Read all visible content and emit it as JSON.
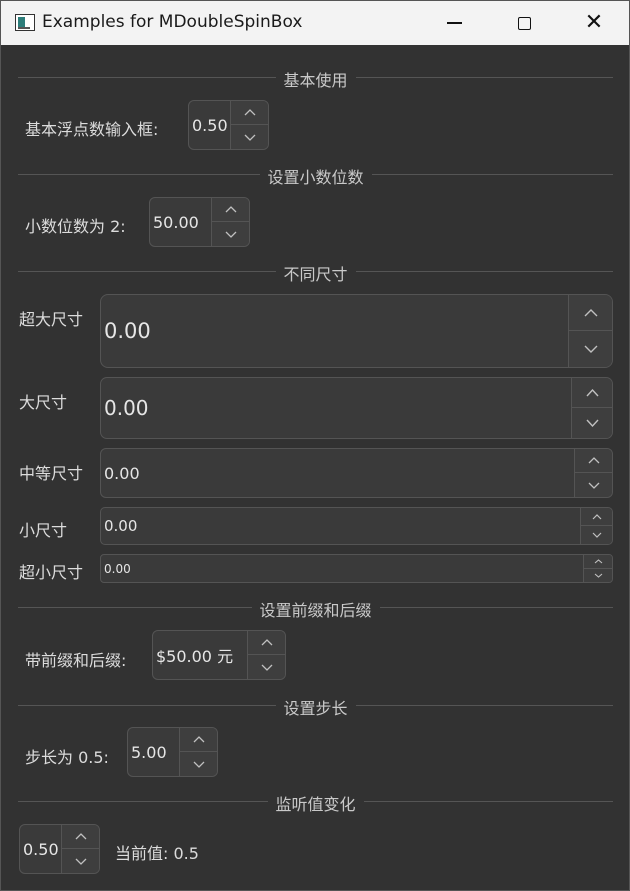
{
  "window": {
    "title": "Examples for MDoubleSpinBox",
    "controls": {
      "minimize": "minimize",
      "maximize": "maximize",
      "close": "close"
    }
  },
  "sections": {
    "basic": "基本使用",
    "decimals": "设置小数位数",
    "sizes": "不同尺寸",
    "prefix_suffix": "设置前缀和后缀",
    "step": "设置步长",
    "listen": "监听值变化"
  },
  "basic": {
    "label": "基本浮点数输入框:",
    "value": "0.50"
  },
  "decimals": {
    "label": "小数位数为 2:",
    "value": "50.00"
  },
  "sizes": {
    "huge": {
      "label": "超大尺寸",
      "value": "0.00"
    },
    "large": {
      "label": "大尺寸",
      "value": "0.00"
    },
    "medium": {
      "label": "中等尺寸",
      "value": "0.00"
    },
    "small": {
      "label": "小尺寸",
      "value": "0.00"
    },
    "tiny": {
      "label": "超小尺寸",
      "value": "0.00"
    }
  },
  "prefix_suffix": {
    "label": "带前缀和后缀:",
    "value": "$50.00 元"
  },
  "step": {
    "label": "步长为 0.5:",
    "value": "5.00"
  },
  "listen": {
    "value": "0.50",
    "current_label": "当前值: 0.5"
  },
  "icons": {
    "up": "chevron-up-icon",
    "down": "chevron-down-icon"
  }
}
